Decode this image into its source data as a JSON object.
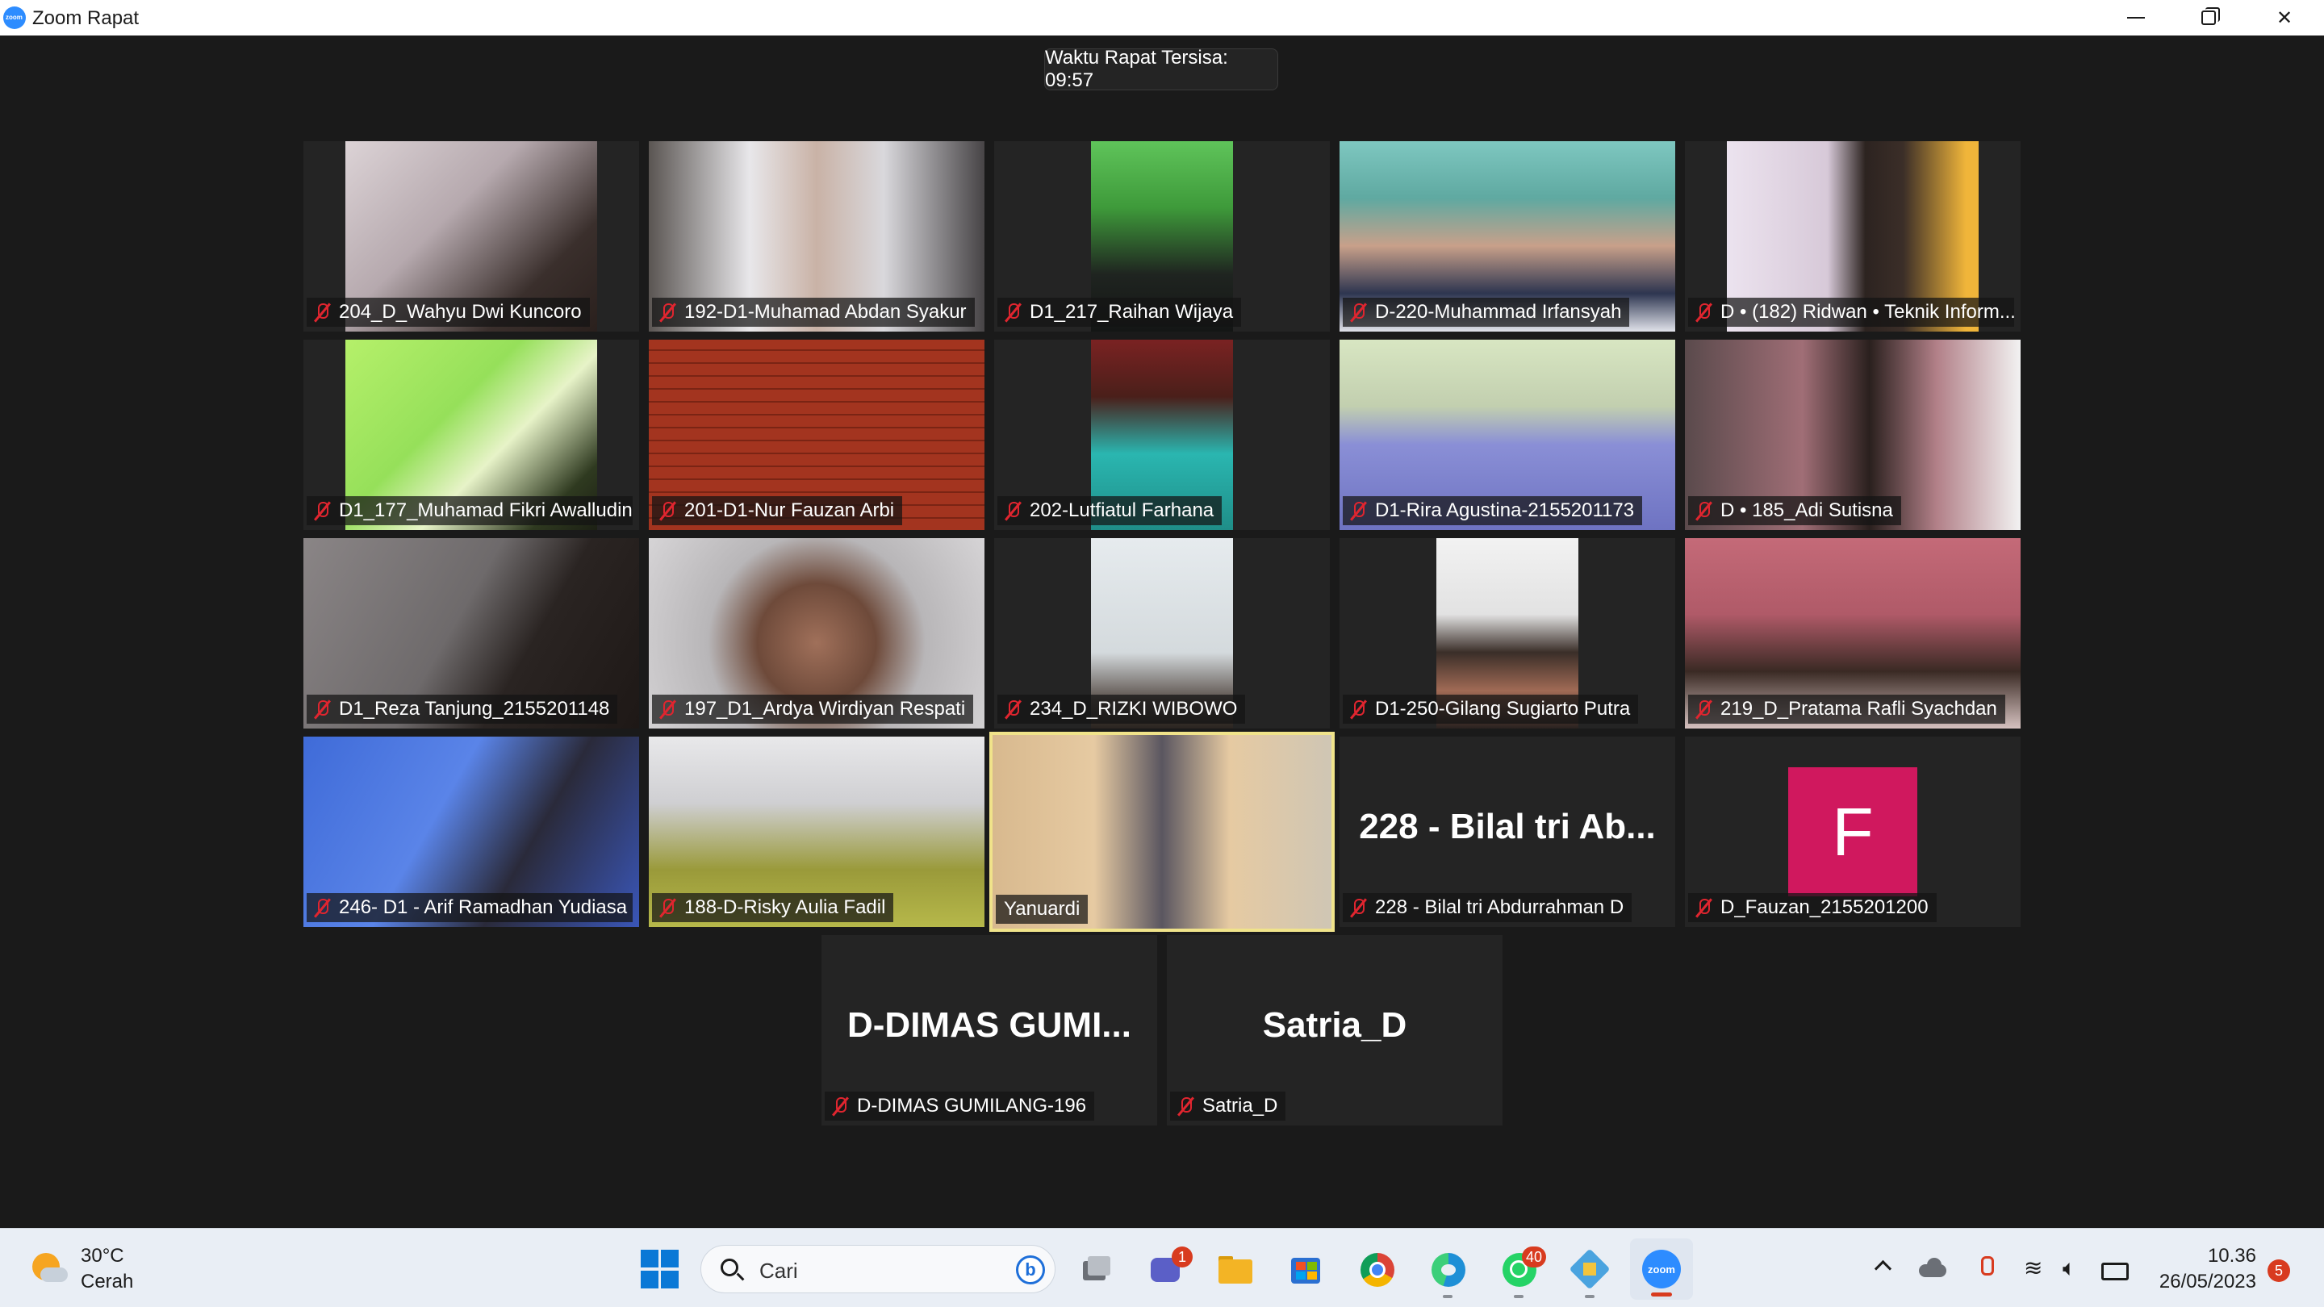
{
  "window": {
    "title": "Zoom Rapat",
    "app_icon_text": "zoom"
  },
  "meeting": {
    "timer_text": "Waktu Rapat Tersisa: 09:57",
    "participants": [
      {
        "name": "204_D_Wahyu Dwi Kuncoro",
        "muted": true,
        "display": "video"
      },
      {
        "name": "192-D1-Muhamad Abdan Syakur",
        "muted": true,
        "display": "video"
      },
      {
        "name": "D1_217_Raihan Wijaya",
        "muted": true,
        "display": "video"
      },
      {
        "name": "D-220-Muhammad Irfansyah",
        "muted": true,
        "display": "video"
      },
      {
        "name": "D • (182) Ridwan • Teknik Inform...",
        "muted": true,
        "display": "video"
      },
      {
        "name": "D1_177_Muhamad Fikri Awalludin",
        "muted": true,
        "display": "video"
      },
      {
        "name": "201-D1-Nur Fauzan Arbi",
        "muted": true,
        "display": "video"
      },
      {
        "name": "202-Lutfiatul Farhana",
        "muted": true,
        "display": "video"
      },
      {
        "name": "D1-Rira Agustina-2155201173",
        "muted": true,
        "display": "video"
      },
      {
        "name": "D • 185_Adi Sutisna",
        "muted": true,
        "display": "video"
      },
      {
        "name": "D1_Reza Tanjung_2155201148",
        "muted": true,
        "display": "video"
      },
      {
        "name": "197_D1_Ardya Wirdiyan Respati",
        "muted": true,
        "display": "video"
      },
      {
        "name": "234_D_RIZKI WIBOWO",
        "muted": true,
        "display": "video"
      },
      {
        "name": "D1-250-Gilang Sugiarto Putra",
        "muted": true,
        "display": "video"
      },
      {
        "name": "219_D_Pratama Rafli Syachdan",
        "muted": true,
        "display": "video"
      },
      {
        "name": "246- D1 - Arif Ramadhan Yudiasa",
        "muted": true,
        "display": "video"
      },
      {
        "name": "188-D-Risky Aulia Fadil",
        "muted": true,
        "display": "video"
      },
      {
        "name": "Yanuardi",
        "muted": false,
        "display": "video",
        "active_speaker": true
      },
      {
        "name": "228 - Bilal tri Abdurrahman D",
        "muted": true,
        "display": "name",
        "big_label": "228 - Bilal tri Ab..."
      },
      {
        "name": "D_Fauzan_2155201200",
        "muted": true,
        "display": "avatar",
        "avatar_letter": "F"
      },
      {
        "name": "D-DIMAS GUMILANG-196",
        "muted": true,
        "display": "name",
        "big_label": "D-DIMAS GUMI..."
      },
      {
        "name": "Satria_D",
        "muted": true,
        "display": "name",
        "big_label": "Satria_D"
      }
    ]
  },
  "taskbar": {
    "weather": {
      "temp": "30°C",
      "desc": "Cerah",
      "icon": "sun-cloud-icon"
    },
    "search": {
      "placeholder": "Cari",
      "bing_label": "b"
    },
    "apps": [
      {
        "name": "start",
        "icon": "windows-start-icon"
      },
      {
        "name": "task-view",
        "icon": "task-view-icon"
      },
      {
        "name": "teams",
        "icon": "teams-chat-icon",
        "badge": "1"
      },
      {
        "name": "file-explorer",
        "icon": "folder-icon"
      },
      {
        "name": "store",
        "icon": "microsoft-store-icon"
      },
      {
        "name": "chrome",
        "icon": "chrome-icon"
      },
      {
        "name": "edge",
        "icon": "edge-icon"
      },
      {
        "name": "whatsapp",
        "icon": "whatsapp-icon",
        "badge": "40"
      },
      {
        "name": "virtualbox",
        "icon": "virtualbox-icon"
      },
      {
        "name": "zoom",
        "icon": "zoom-icon",
        "label": "zoom"
      }
    ],
    "tray": {
      "time": "10.36",
      "date": "26/05/2023",
      "notification_count": "5",
      "wifi_glyph": "≋",
      "volume_glyph": "🔈︎"
    }
  },
  "colors": {
    "meeting_bg": "#1a1a1a",
    "tile_bg": "#242424",
    "mute_red": "#e0252f",
    "active_speaker_border": "#f0e38a",
    "avatar_pink": "#d0185e",
    "zoom_blue": "#2d8cff"
  }
}
